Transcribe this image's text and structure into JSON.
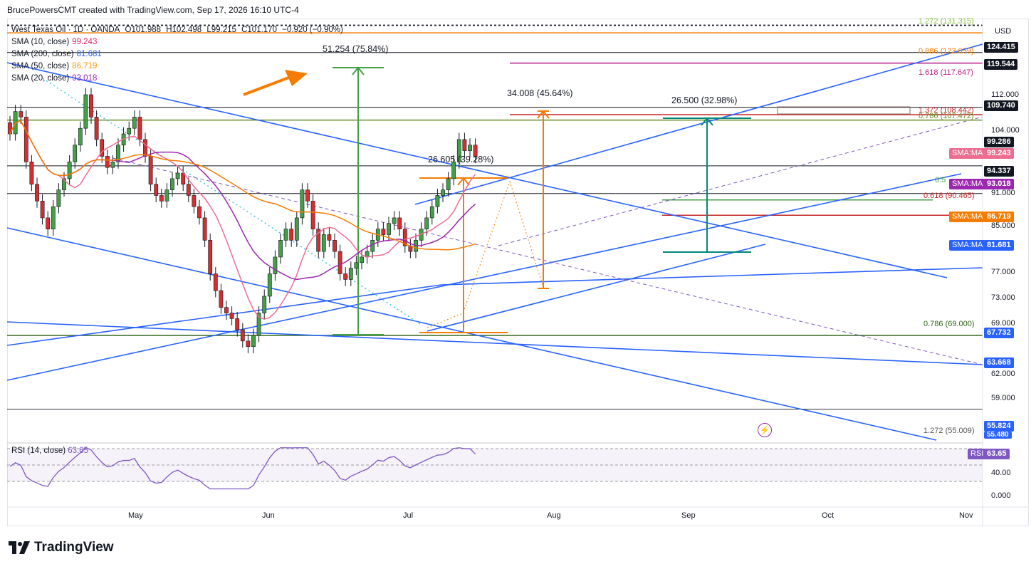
{
  "header": {
    "credit": "BrucePowersCMT created with TradingView.com, Sep 17, 2026 16:10 UTC-4"
  },
  "symbol": {
    "name": "West Texas Oil · 1D · OANDA",
    "open": "O101.988",
    "high": "H102.498",
    "low": "L99.215",
    "close": "C101.170",
    "change": "−0.920 (−0.90%)"
  },
  "legend": [
    {
      "name": "SMA (10, close)",
      "value": "99.243",
      "color": "#e91e63"
    },
    {
      "name": "SMA (200, close)",
      "value": "81.681",
      "color": "#2962ff"
    },
    {
      "name": "SMA (50, close)",
      "value": "86.719",
      "color": "#ff9800"
    },
    {
      "name": "SMA (20, close)",
      "value": "93.018",
      "color": "#9c27b0"
    }
  ],
  "currency": "USD",
  "price_badges": [
    {
      "label": "124.415",
      "color": "#131722"
    },
    {
      "label": "119.544",
      "color": "#131722"
    },
    {
      "label": "109.740",
      "color": "#131722"
    },
    {
      "label": "99.286",
      "color": "#131722"
    },
    {
      "label": "94.337",
      "color": "#131722"
    },
    {
      "label": "67.732",
      "color": "#2962ff"
    },
    {
      "label": "63.668",
      "color": "#2962ff"
    },
    {
      "label": "55.824",
      "color": "#2962ff"
    },
    {
      "label": "55.480",
      "color": "#2962ff"
    }
  ],
  "ma_badges": [
    {
      "label": "SMA:MA",
      "value": "99.243",
      "color": "#ec6d91"
    },
    {
      "label": "SMA:MA",
      "value": "93.018",
      "color": "#9c27b0"
    },
    {
      "label": "SMA:MA",
      "value": "86.719",
      "color": "#f57c00"
    },
    {
      "label": "SMA:MA",
      "value": "81.681",
      "color": "#2962ff"
    }
  ],
  "price_ticks": [
    "112.000",
    "104.000",
    "91.000",
    "85.000",
    "77.000",
    "73.000",
    "69.000",
    "62.000",
    "59.000"
  ],
  "fib_labels": [
    {
      "text": "1.272 (131.315)",
      "color": "#8bc34a"
    },
    {
      "text": "0.886 (123.059)",
      "color": "#f57c00"
    },
    {
      "text": "1.618 (117.647)",
      "color": "#b71c8c"
    },
    {
      "text": "1.372 (108.442)",
      "color": "#c62828"
    },
    {
      "text": "0.786 (107.472)",
      "color": "#6a8f2a"
    },
    {
      "text": "0.5",
      "color": "#43a047"
    },
    {
      "text": "0.618 (90.465)",
      "color": "#c62828"
    },
    {
      "text": "0.786 (69.000)",
      "color": "#33691e"
    },
    {
      "text": "1.272 (55.009)",
      "color": "#555555"
    }
  ],
  "measure_labels": [
    "51.254 (75.84%)",
    "34.008 (45.64%)",
    "26.605 (39.28%)",
    "26.500 (32.98%)"
  ],
  "x_ticks": [
    "May",
    "Jun",
    "Jul",
    "Aug",
    "Sep",
    "Oct",
    "Nov"
  ],
  "rsi": {
    "name": "RSI (14, close)",
    "value": "63.65",
    "badge_label": "RSI",
    "ticks": [
      "40.00",
      "0.000"
    ],
    "color": "#7e57c2"
  },
  "brand": "TradingView",
  "chart_data": {
    "type": "candlestick",
    "title": "West Texas Oil · 1D · OANDA",
    "ylim": [
      55,
      128
    ],
    "x_ticks": [
      "May",
      "Jun",
      "Jul",
      "Aug",
      "Sep",
      "Oct",
      "Nov"
    ],
    "closes_approx": [
      105,
      109,
      108,
      100,
      96,
      93,
      90,
      88,
      92,
      95,
      97,
      100,
      103,
      106,
      112,
      108,
      104,
      101,
      99,
      100,
      103,
      105,
      106,
      108,
      104,
      101,
      96,
      94,
      93,
      95,
      97,
      98,
      96,
      94,
      92,
      90,
      86,
      80,
      77,
      74,
      73,
      72,
      70,
      68,
      67,
      69,
      73,
      76,
      80,
      83,
      86,
      88,
      86,
      90,
      95,
      93,
      88,
      84,
      87,
      86,
      84,
      80,
      79,
      81,
      82,
      83,
      84,
      86,
      88,
      87,
      89,
      90,
      88,
      85,
      84,
      86,
      88,
      90,
      92,
      94,
      95,
      97,
      100,
      104,
      102,
      103,
      101
    ],
    "series": [
      {
        "name": "SMA (10, close)",
        "last": 99.243
      },
      {
        "name": "SMA (20, close)",
        "last": 93.018
      },
      {
        "name": "SMA (50, close)",
        "last": 86.719
      },
      {
        "name": "SMA (200, close)",
        "last": 81.681
      }
    ]
  }
}
